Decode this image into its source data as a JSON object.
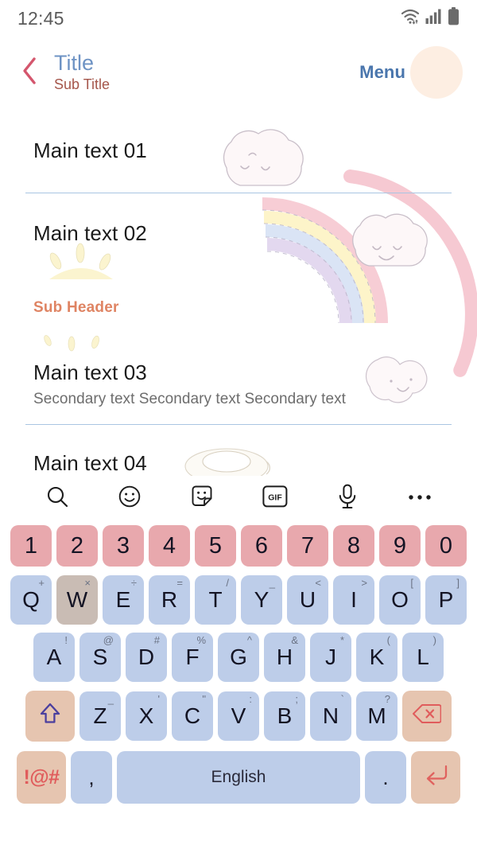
{
  "status_bar": {
    "time": "12:45",
    "icons": [
      "wifi-icon",
      "signal-icon",
      "battery-icon"
    ]
  },
  "app_bar": {
    "back_icon": "back-chevron-icon",
    "title": "Title",
    "subtitle": "Sub Title",
    "menu_label": "Menu",
    "overflow_icon": "more-vertical-icon",
    "colors": {
      "title": "#6e93c4",
      "subtitle": "#a5564b",
      "menu": "#4a76ad",
      "back": "#d4566d",
      "ripple": "#fdeee2"
    }
  },
  "content": {
    "rows": [
      {
        "main": "Main text 01",
        "secondary": ""
      },
      {
        "main": "Main text 02",
        "secondary": ""
      },
      {
        "main": "Main text 03",
        "secondary": "Secondary text Secondary text Secondary text"
      },
      {
        "main": "Main text 04",
        "secondary": ""
      }
    ],
    "sub_header": "Sub Header",
    "divider_color": "#a9c5e2",
    "sub_header_color": "#df8463"
  },
  "keyboard": {
    "toolbar": [
      {
        "icon": "search-icon"
      },
      {
        "icon": "emoji-icon"
      },
      {
        "icon": "sticker-icon"
      },
      {
        "icon": "gif-icon",
        "label": "GIF"
      },
      {
        "icon": "microphone-icon"
      },
      {
        "icon": "more-horizontal-icon"
      }
    ],
    "number_row": [
      "1",
      "2",
      "3",
      "4",
      "5",
      "6",
      "7",
      "8",
      "9",
      "0"
    ],
    "row_q": [
      {
        "key": "Q",
        "sup": "+"
      },
      {
        "key": "W",
        "sup": "×",
        "pressed": true
      },
      {
        "key": "E",
        "sup": "÷"
      },
      {
        "key": "R",
        "sup": "="
      },
      {
        "key": "T",
        "sup": "/"
      },
      {
        "key": "Y",
        "sup": "_"
      },
      {
        "key": "U",
        "sup": "<"
      },
      {
        "key": "I",
        "sup": ">"
      },
      {
        "key": "O",
        "sup": "["
      },
      {
        "key": "P",
        "sup": "]"
      }
    ],
    "row_a": [
      {
        "key": "A",
        "sup": "!"
      },
      {
        "key": "S",
        "sup": "@"
      },
      {
        "key": "D",
        "sup": "#"
      },
      {
        "key": "F",
        "sup": "%"
      },
      {
        "key": "G",
        "sup": "^"
      },
      {
        "key": "H",
        "sup": "&"
      },
      {
        "key": "J",
        "sup": "*"
      },
      {
        "key": "K",
        "sup": "("
      },
      {
        "key": "L",
        "sup": ")"
      }
    ],
    "row_z": [
      {
        "key": "Z",
        "sup": "_"
      },
      {
        "key": "X",
        "sup": "'"
      },
      {
        "key": "C",
        "sup": "\""
      },
      {
        "key": "V",
        "sup": ":"
      },
      {
        "key": "B",
        "sup": ";"
      },
      {
        "key": "N",
        "sup": "`"
      },
      {
        "key": "M",
        "sup": "?"
      }
    ],
    "shift_icon": "shift-arrow-icon",
    "backspace_icon": "backspace-icon",
    "symbols_label": "!@#",
    "comma_label": ",",
    "space_label": "English",
    "period_label": ".",
    "enter_icon": "enter-arrow-icon",
    "colors": {
      "number_key": "#e8a8ad",
      "letter_key": "#bdcde9",
      "pressed_key": "#c9bcb4",
      "function_key": "#e6c5b0",
      "shift_arrow": "#4b3f9e",
      "backspace_x": "#e05c5c",
      "enter_arrow": "#e0625e",
      "symbols_text": "#e05c5c"
    }
  }
}
